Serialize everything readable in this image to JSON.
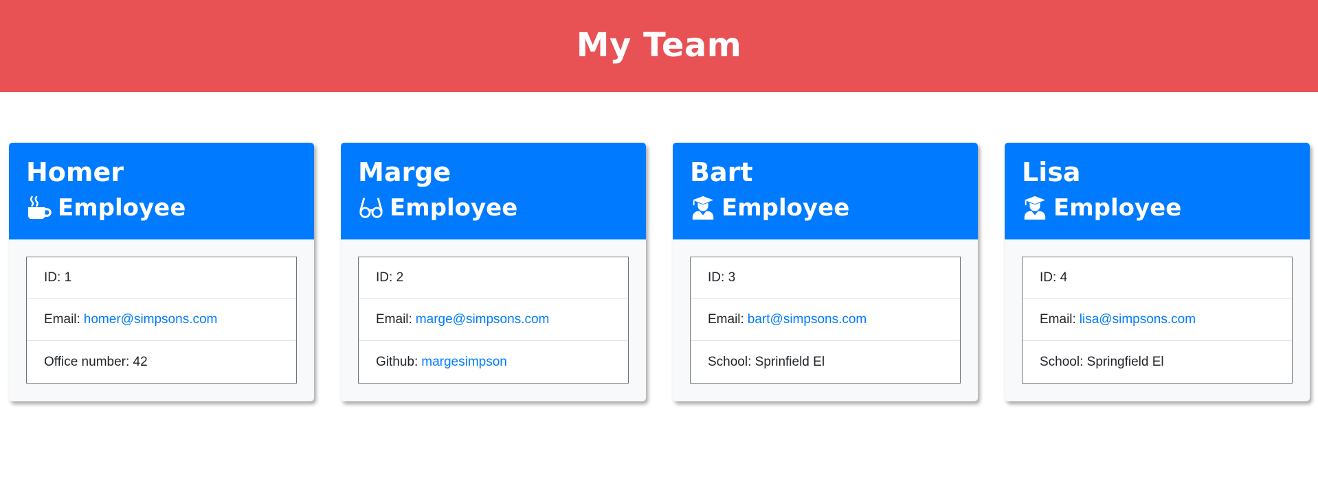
{
  "header": {
    "title": "My Team"
  },
  "members": [
    {
      "name": "Homer",
      "role": "Employee",
      "icon": "coffee-mug-icon",
      "id_label": "ID:",
      "id": "1",
      "email_label": "Email:",
      "email": "homer@simpsons.com",
      "extra_label": "Office number:",
      "extra_value": "42"
    },
    {
      "name": "Marge",
      "role": "Employee",
      "icon": "glasses-icon",
      "id_label": "ID:",
      "id": "2",
      "email_label": "Email:",
      "email": "marge@simpsons.com",
      "extra_label": "Github:",
      "extra_value": "margesimpson"
    },
    {
      "name": "Bart",
      "role": "Employee",
      "icon": "graduate-icon",
      "id_label": "ID:",
      "id": "3",
      "email_label": "Email:",
      "email": "bart@simpsons.com",
      "extra_label": "School:",
      "extra_value": "Sprinfield El"
    },
    {
      "name": "Lisa",
      "role": "Employee",
      "icon": "graduate-icon",
      "id_label": "ID:",
      "id": "4",
      "email_label": "Email:",
      "email": "lisa@simpsons.com",
      "extra_label": "School:",
      "extra_value": "Springfield El"
    }
  ],
  "colors": {
    "banner": "#e85255",
    "card_header": "#007bff",
    "link": "#007bff"
  }
}
